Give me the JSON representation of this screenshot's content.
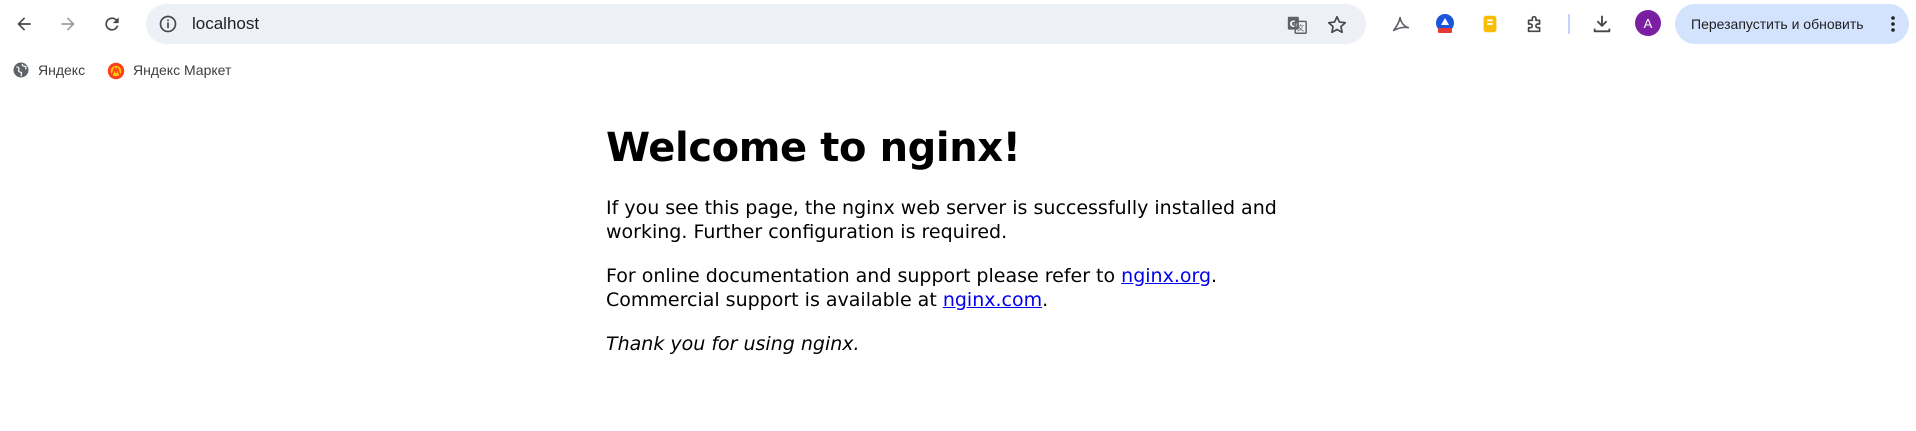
{
  "browser": {
    "address_bar": {
      "url": "localhost"
    },
    "avatar_letter": "A",
    "relaunch_button": {
      "label": "Перезапустить и обновить"
    },
    "icons": {
      "back": "back-arrow-icon",
      "forward": "forward-arrow-icon",
      "reload": "reload-icon",
      "site_info": "info-icon",
      "translate": "translate-icon",
      "bookmark": "star-icon",
      "acrobat": "acrobat-extension-icon",
      "vpn": "vpn-extension-icon",
      "notes": "notes-extension-icon",
      "extensions": "puzzle-icon",
      "downloads": "download-icon",
      "menu": "kebab-menu-icon"
    },
    "accent_colors": {
      "omnibox_bg": "#edf0f7",
      "relaunch_bg": "#d3e3fd",
      "avatar_bg": "#7b1fa2"
    }
  },
  "bookmarks": [
    {
      "label": "Яндекс",
      "icon": "globe-icon"
    },
    {
      "label": "Яндекс Маркет",
      "icon": "yandex-market-icon"
    }
  ],
  "page": {
    "title": "Welcome to nginx!",
    "paragraph1": "If you see this page, the nginx web server is successfully installed and working. Further configuration is required.",
    "paragraph2_prefix": "For online documentation and support please refer to ",
    "link_org": "nginx.org",
    "paragraph2_mid": ".",
    "paragraph2_line2_prefix": "Commercial support is available at ",
    "link_com": "nginx.com",
    "paragraph2_end": ".",
    "thanks": "Thank you for using nginx."
  }
}
